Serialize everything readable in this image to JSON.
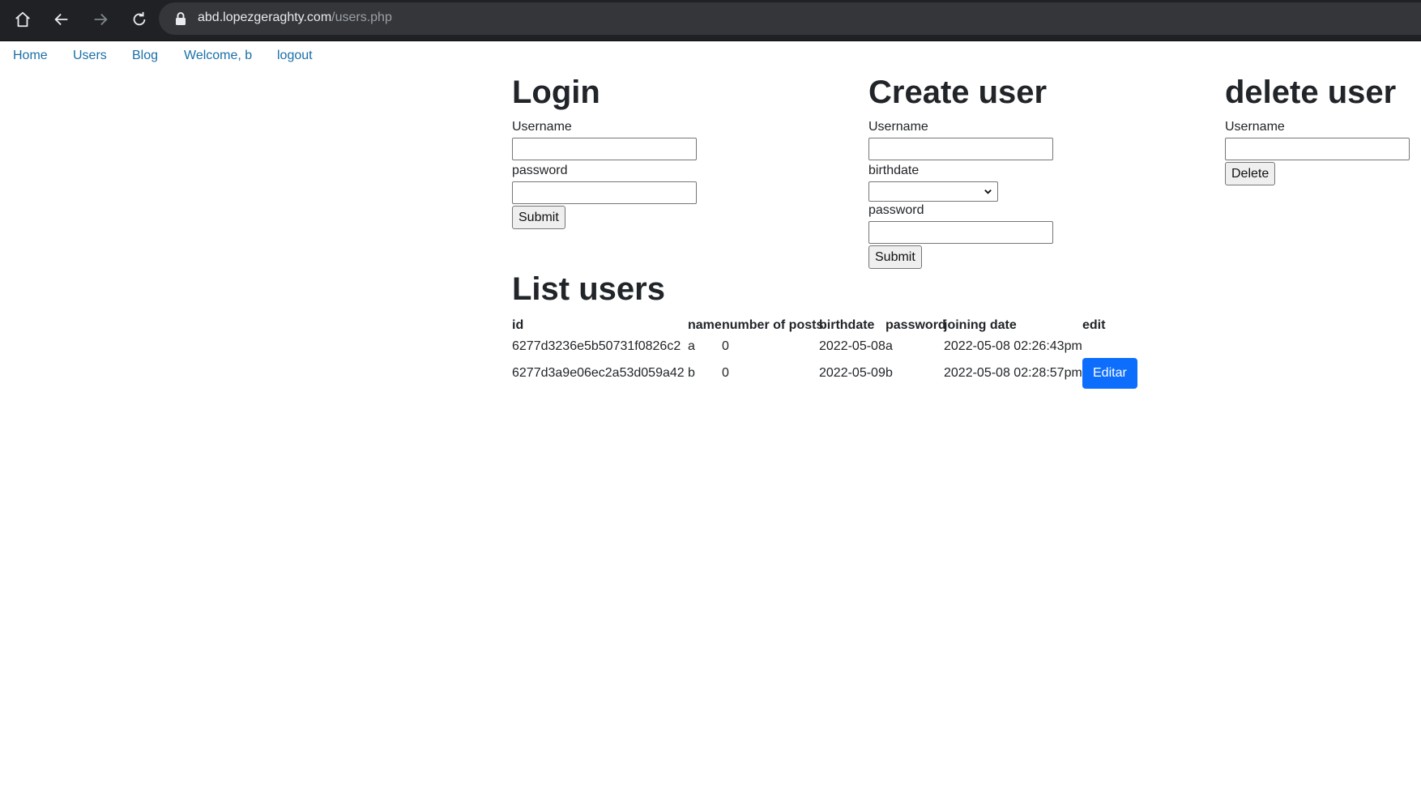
{
  "browser": {
    "url_host": "abd.lopezgeraghty.com",
    "url_path": "/users.php"
  },
  "nav": {
    "items": [
      "Home",
      "Users",
      "Blog",
      "Welcome, b",
      "logout"
    ]
  },
  "login": {
    "title": "Login",
    "username_label": "Username",
    "password_label": "password",
    "submit_label": "Submit"
  },
  "create_user": {
    "title": "Create user",
    "username_label": "Username",
    "birthdate_label": "birthdate",
    "password_label": "password",
    "submit_label": "Submit"
  },
  "delete_user": {
    "title": "delete user",
    "username_label": "Username",
    "delete_label": "Delete"
  },
  "list_users": {
    "title": "List users",
    "columns": [
      "id",
      "name",
      "number of posts",
      "birthdate",
      "password",
      "joining date",
      "edit"
    ],
    "rows": [
      [
        "6277d3236e5b50731f0826c2",
        "a",
        "0",
        "2022-05-08",
        "a",
        "2022-05-08 02:26:43pm",
        ""
      ],
      [
        "6277d3a9e06ec2a53d059a42",
        "b",
        "0",
        "2022-05-09",
        "b",
        "2022-05-08 02:28:57pm",
        "Editar"
      ]
    ]
  },
  "colors": {
    "link": "#1a6fa8",
    "primary_button": "#0d6efd",
    "toolbar": "#202124"
  }
}
